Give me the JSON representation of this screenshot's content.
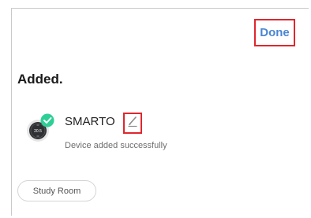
{
  "header": {
    "done_label": "Done"
  },
  "main": {
    "title": "Added.",
    "device": {
      "name": "SMARTO",
      "status": "Device added successfully",
      "thermostat_temp": "20.5",
      "icon": "thermostat-icon",
      "check_icon": "checkmark-icon",
      "edit_icon": "pencil-icon"
    },
    "room": {
      "label": "Study Room"
    }
  },
  "colors": {
    "accent": "#4a86d4",
    "success": "#2ecf97",
    "highlight_border": "#e0262d"
  }
}
